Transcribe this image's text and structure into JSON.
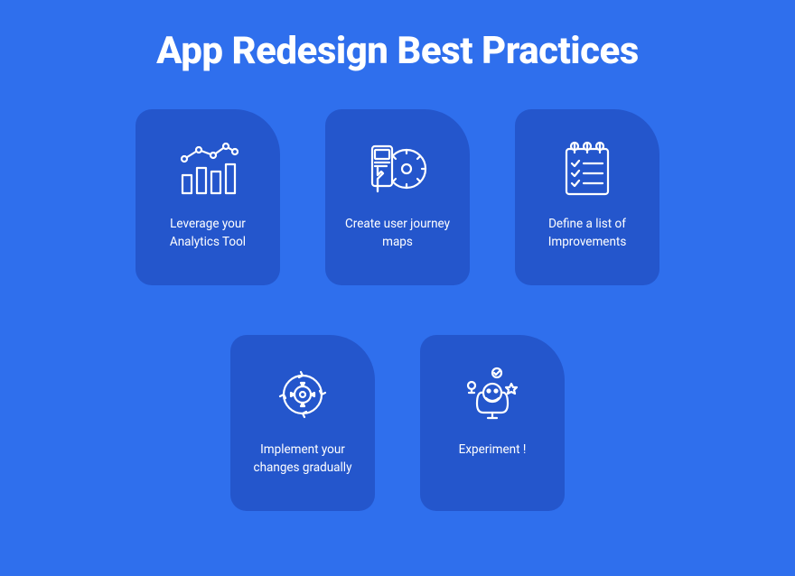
{
  "title": "App Redesign Best Practices",
  "cards": [
    {
      "icon": "analytics-chart-icon",
      "label": "Leverage your Analytics Tool"
    },
    {
      "icon": "journey-map-icon",
      "label": "Create user journey maps"
    },
    {
      "icon": "improvements-list-icon",
      "label": "Define a list of Improvements"
    },
    {
      "icon": "gradual-change-icon",
      "label": "Implement your changes gradually"
    },
    {
      "icon": "experiment-icon",
      "label": "Experiment !"
    }
  ]
}
